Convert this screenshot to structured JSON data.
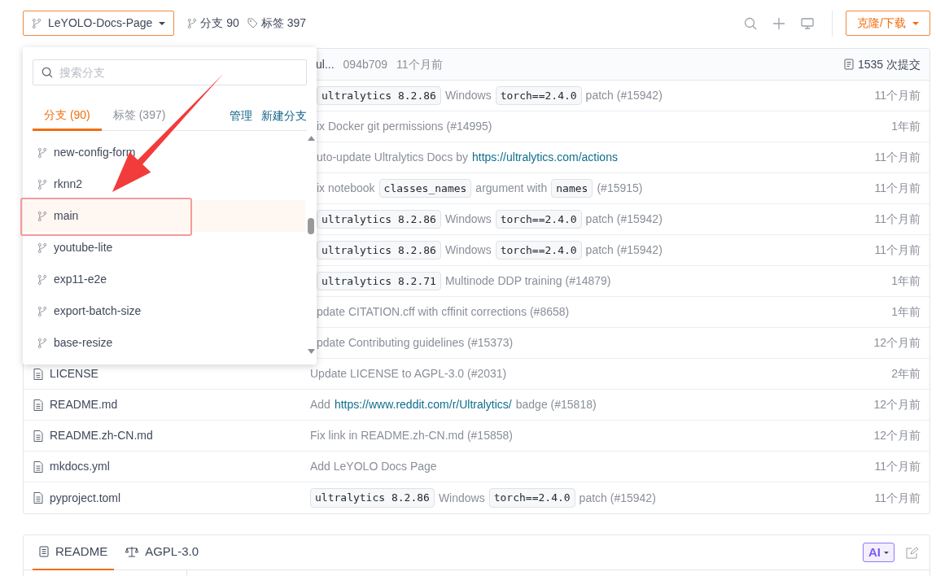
{
  "repo_bar": {
    "branch_button": "LeYOLO-Docs-Page",
    "branches_count": "分支 90",
    "tags_count": "标签 397",
    "clone_button": "克隆/下载"
  },
  "latest_commit": {
    "message": "ul...",
    "hash": "094b709",
    "time": "11个月前",
    "commits": "1535 次提交"
  },
  "files": [
    {
      "message": [
        {
          "kind": "code",
          "text": "ultralytics 8.2.86"
        },
        {
          "kind": "text",
          "text": "Windows"
        },
        {
          "kind": "code",
          "text": "torch==2.4.0"
        },
        {
          "kind": "text",
          "text": "patch (#15942)"
        }
      ],
      "time": "11个月前"
    },
    {
      "message": [
        {
          "kind": "text",
          "text": "ix Docker git permissions (#14995)"
        }
      ],
      "time": "1年前"
    },
    {
      "message": [
        {
          "kind": "text",
          "text": "uto-update Ultralytics Docs by"
        },
        {
          "kind": "link",
          "text": "https://ultralytics.com/actions"
        }
      ],
      "time": "11个月前"
    },
    {
      "message": [
        {
          "kind": "text",
          "text": "ix notebook"
        },
        {
          "kind": "code",
          "text": "classes_names"
        },
        {
          "kind": "text",
          "text": "argument with"
        },
        {
          "kind": "code",
          "text": "names"
        },
        {
          "kind": "text",
          "text": "(#15915)"
        }
      ],
      "time": "11个月前"
    },
    {
      "message": [
        {
          "kind": "code",
          "text": "ultralytics 8.2.86"
        },
        {
          "kind": "text",
          "text": "Windows"
        },
        {
          "kind": "code",
          "text": "torch==2.4.0"
        },
        {
          "kind": "text",
          "text": "patch (#15942)"
        }
      ],
      "time": "11个月前"
    },
    {
      "message": [
        {
          "kind": "code",
          "text": "ultralytics 8.2.86"
        },
        {
          "kind": "text",
          "text": "Windows"
        },
        {
          "kind": "code",
          "text": "torch==2.4.0"
        },
        {
          "kind": "text",
          "text": "patch (#15942)"
        }
      ],
      "time": "11个月前"
    },
    {
      "message": [
        {
          "kind": "code",
          "text": "ultralytics 8.2.71"
        },
        {
          "kind": "text",
          "text": "Multinode DDP training (#14879)"
        }
      ],
      "time": "1年前"
    },
    {
      "message": [
        {
          "kind": "text",
          "text": "pdate CITATION.cff with cffinit corrections (#8658)"
        }
      ],
      "time": "1年前"
    },
    {
      "message": [
        {
          "kind": "text",
          "text": "pdate Contributing guidelines (#15373)"
        }
      ],
      "time": "12个月前"
    },
    {
      "name": "LICENSE",
      "message": [
        {
          "kind": "text",
          "text": "Update LICENSE to AGPL-3.0 (#2031)"
        }
      ],
      "time": "2年前"
    },
    {
      "name": "README.md",
      "message": [
        {
          "kind": "text",
          "text": "Add"
        },
        {
          "kind": "link",
          "text": "https://www.reddit.com/r/Ultralytics/"
        },
        {
          "kind": "text",
          "text": "badge (#15818)"
        }
      ],
      "time": "12个月前"
    },
    {
      "name": "README.zh-CN.md",
      "message": [
        {
          "kind": "text",
          "text": "Fix link in README.zh-CN.md (#15858)"
        }
      ],
      "time": "12个月前"
    },
    {
      "name": "mkdocs.yml",
      "message": [
        {
          "kind": "text",
          "text": "Add LeYOLO Docs Page"
        }
      ],
      "time": "11个月前"
    },
    {
      "name": "pyproject.toml",
      "message": [
        {
          "kind": "code",
          "text": "ultralytics 8.2.86"
        },
        {
          "kind": "text",
          "text": "Windows"
        },
        {
          "kind": "code",
          "text": "torch==2.4.0"
        },
        {
          "kind": "text",
          "text": "patch (#15942)"
        }
      ],
      "time": "11个月前"
    }
  ],
  "branch_dropdown": {
    "search": {
      "placeholder": "搜索分支"
    },
    "tabs": [
      {
        "label": "分支 (90)",
        "selected": true
      },
      {
        "label": "标签 (397)",
        "selected": false
      }
    ],
    "actions": [
      "管理",
      "新建分支"
    ],
    "branches": [
      {
        "name": "new-config-form",
        "selected": false
      },
      {
        "name": "rknn2",
        "selected": false
      },
      {
        "name": "main",
        "selected": true
      },
      {
        "name": "youtube-lite",
        "selected": false
      },
      {
        "name": "exp11-e2e",
        "selected": false
      },
      {
        "name": "export-batch-size",
        "selected": false
      },
      {
        "name": "base-resize",
        "selected": false
      }
    ]
  },
  "readme_panel": {
    "tabs": [
      {
        "kind": "readme",
        "label": "README",
        "selected": true
      },
      {
        "kind": "license",
        "label": "AGPL-3.0",
        "selected": false
      }
    ],
    "ai_button": "AI"
  }
}
